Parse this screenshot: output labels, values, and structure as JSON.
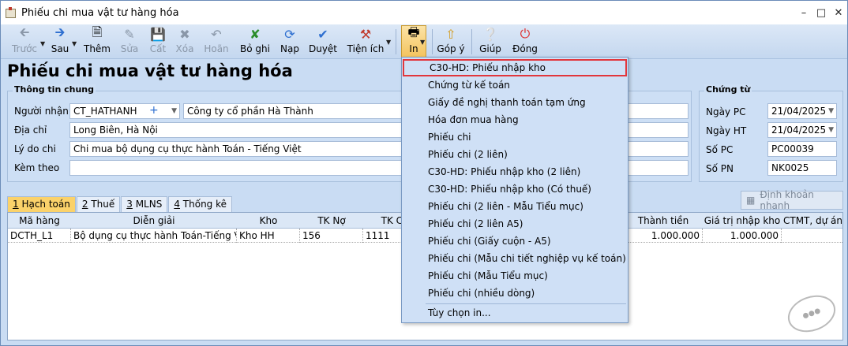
{
  "window": {
    "title": "Phiếu chi mua vật tư hàng hóa"
  },
  "toolbar": [
    {
      "key": "truoc",
      "label": "Trước",
      "disabled": true
    },
    {
      "key": "sau",
      "label": "Sau",
      "disabled": false
    },
    {
      "key": "them",
      "label": "Thêm",
      "disabled": false
    },
    {
      "key": "sua",
      "label": "Sửa",
      "disabled": true
    },
    {
      "key": "cat",
      "label": "Cất",
      "disabled": true
    },
    {
      "key": "xoa",
      "label": "Xóa",
      "disabled": true
    },
    {
      "key": "hoan",
      "label": "Hoãn",
      "disabled": true
    },
    {
      "key": "boghi",
      "label": "Bỏ ghi",
      "disabled": false
    },
    {
      "key": "nap",
      "label": "Nạp",
      "disabled": false
    },
    {
      "key": "duyet",
      "label": "Duyệt",
      "disabled": false
    },
    {
      "key": "tienich",
      "label": "Tiện ích",
      "disabled": false
    },
    {
      "key": "in",
      "label": "In",
      "disabled": false
    },
    {
      "key": "gopy",
      "label": "Góp ý",
      "disabled": false
    },
    {
      "key": "giup",
      "label": "Giúp",
      "disabled": false
    },
    {
      "key": "dong",
      "label": "Đóng",
      "disabled": false
    }
  ],
  "page_title": "Phiếu chi mua vật tư hàng hóa",
  "general": {
    "group_title": "Thông tin chung",
    "nguoi_nhan_label": "Người nhận",
    "nguoi_nhan_code": "CT_HATHANH",
    "nguoi_nhan_name": "Công ty cổ phần Hà Thành",
    "dia_chi_label": "Địa chỉ",
    "dia_chi": "Long Biên, Hà Nội",
    "ly_do_label": "Lý do chi",
    "ly_do": "Chi mua bộ dụng cụ thực hành Toán - Tiếng Việt",
    "kem_theo_label": "Kèm theo",
    "kem_theo": ""
  },
  "voucher": {
    "group_title": "Chứng từ",
    "ngay_pc_label": "Ngày PC",
    "ngay_pc": "21/04/2025",
    "ngay_ht_label": "Ngày HT",
    "ngay_ht": "21/04/2025",
    "so_pc_label": "Số PC",
    "so_pc": "PC00039",
    "so_pn_label": "Số PN",
    "so_pn": "NK0025"
  },
  "tabs": [
    {
      "key": "1",
      "label": " Hạch toán",
      "active": true
    },
    {
      "key": "2",
      "label": " Thuế",
      "active": false
    },
    {
      "key": "3",
      "label": " MLNS",
      "active": false
    },
    {
      "key": "4",
      "label": " Thống kê",
      "active": false
    }
  ],
  "dinh_khoan_button": "Định khoản nhanh",
  "grid": {
    "headers": {
      "ma_hang": "Mã hàng",
      "dien_giai": "Diễn giải",
      "kho": "Kho",
      "tk_no": "TK Nợ",
      "tk_co": "TK Có",
      "thanh_tien": "Thành tiền",
      "gia_tri": "Giá trị nhập kho",
      "ctmt": "CTMT, dự án"
    },
    "row": {
      "ma_hang": "DCTH_L1",
      "dien_giai": "Bộ dụng cụ thực hành Toán-Tiếng Việt...",
      "kho": "Kho HH",
      "tk_no": "156",
      "tk_co": "1111",
      "thanh_tien": "1.000.000",
      "gia_tri": "1.000.000"
    }
  },
  "print_menu": {
    "items": [
      "C30-HD: Phiếu nhập kho",
      "Chứng từ kế toán",
      "Giấy đề nghị thanh toán tạm ứng",
      "Hóa đơn mua hàng",
      "Phiếu chi",
      "Phiếu chi (2 liên)",
      "C30-HD: Phiếu nhập kho (2 liên)",
      "C30-HD: Phiếu nhập kho (Có thuế)",
      "Phiếu chi (2 liên - Mẫu Tiểu mục)",
      "Phiếu chi (2 liên A5)",
      "Phiếu chi (Giấy cuộn - A5)",
      "Phiếu chi (Mẫu chi tiết nghiệp vụ kế toán)",
      "Phiếu chi (Mẫu Tiểu mục)",
      "Phiếu chi (nhiều dòng)"
    ],
    "custom": "Tùy chọn in...",
    "highlight_color": "#e2363c"
  }
}
